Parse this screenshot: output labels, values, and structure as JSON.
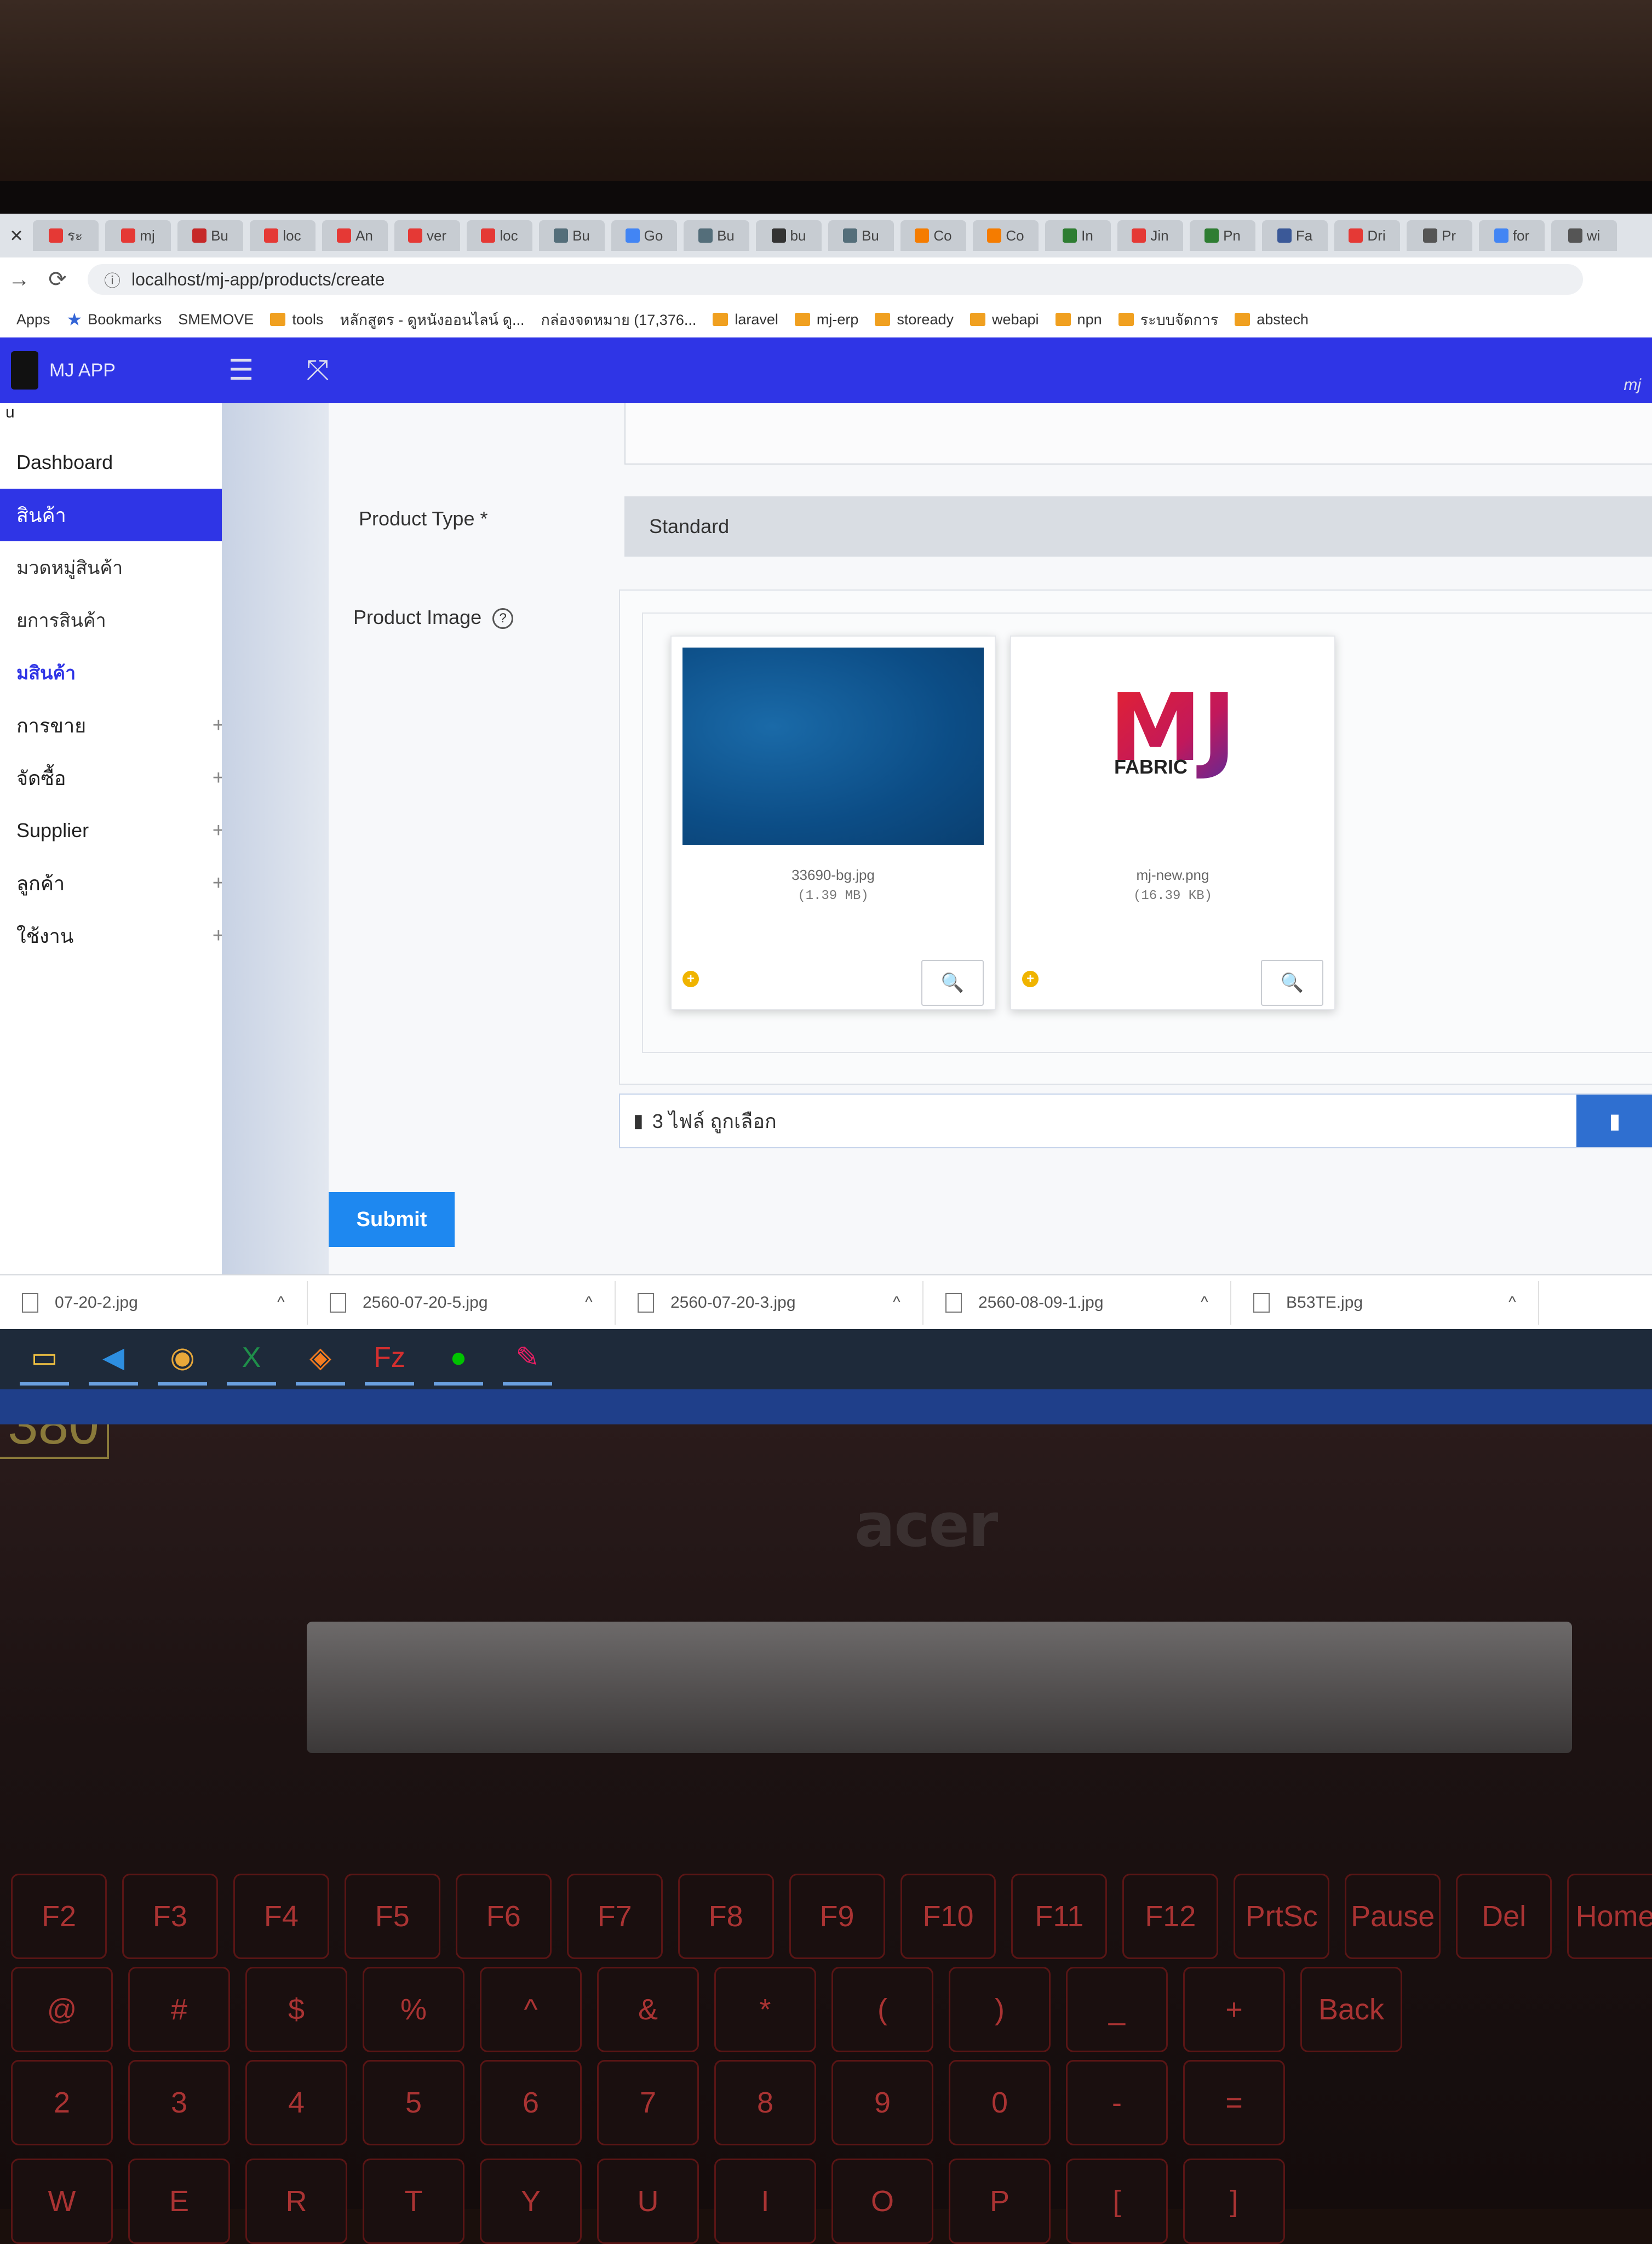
{
  "browser": {
    "tab_close": "×",
    "tabs": [
      {
        "label": "ระ",
        "color": "#e53935"
      },
      {
        "label": "mj",
        "color": "#e53935"
      },
      {
        "label": "Bu",
        "color": "#c62828"
      },
      {
        "label": "loc",
        "color": "#e53935"
      },
      {
        "label": "An",
        "color": "#e53935"
      },
      {
        "label": "ver",
        "color": "#e53935"
      },
      {
        "label": "loc",
        "color": "#e53935"
      },
      {
        "label": "Bu",
        "color": "#546e7a"
      },
      {
        "label": "Go",
        "color": "#4285f4"
      },
      {
        "label": "Bu",
        "color": "#546e7a"
      },
      {
        "label": "bu",
        "color": "#333333"
      },
      {
        "label": "Bu",
        "color": "#546e7a"
      },
      {
        "label": "Co",
        "color": "#f57c00"
      },
      {
        "label": "Co",
        "color": "#f57c00"
      },
      {
        "label": "In",
        "color": "#2e7d32"
      },
      {
        "label": "Jin",
        "color": "#e53935"
      },
      {
        "label": "Pn",
        "color": "#2e7d32"
      },
      {
        "label": "Fa",
        "color": "#3b5998"
      },
      {
        "label": "Dri",
        "color": "#e53935"
      },
      {
        "label": "Pr",
        "color": "#555555"
      },
      {
        "label": "for",
        "color": "#4285f4"
      },
      {
        "label": "wi",
        "color": "#555555"
      }
    ],
    "url": "localhost/mj-app/products/create",
    "bookmarks": [
      {
        "label": "Apps",
        "kind": "apps"
      },
      {
        "label": "Bookmarks",
        "kind": "star"
      },
      {
        "label": "SMEMOVE",
        "kind": "arrow"
      },
      {
        "label": "tools",
        "kind": "folder"
      },
      {
        "label": "หลักสูตร - ดูหนังออนไลน์ ดู...",
        "kind": "site"
      },
      {
        "label": "กล่องจดหมาย (17,376...",
        "kind": "gmail"
      },
      {
        "label": "laravel",
        "kind": "folder"
      },
      {
        "label": "mj-erp",
        "kind": "folder"
      },
      {
        "label": "stoready",
        "kind": "folder"
      },
      {
        "label": "webapi",
        "kind": "folder"
      },
      {
        "label": "npn",
        "kind": "folder"
      },
      {
        "label": "ระบบจัดการ",
        "kind": "folder"
      },
      {
        "label": "abstech",
        "kind": "folder"
      }
    ]
  },
  "app": {
    "name": "MJ APP",
    "hamburger_icon": "☰",
    "fullscreen_icon": "⤧",
    "header_right": "mj"
  },
  "sidebar": {
    "heading": "u",
    "items": [
      {
        "label": "Dashboard",
        "type": "top"
      },
      {
        "label": "สินค้า",
        "type": "active",
        "toggle": "−"
      },
      {
        "label": "มวดหมู่สินค้า",
        "type": "sub"
      },
      {
        "label": "ยการสินค้า",
        "type": "sub"
      },
      {
        "label": "มสินค้า",
        "type": "current"
      },
      {
        "label": "การขาย",
        "type": "group",
        "toggle": "+"
      },
      {
        "label": "จัดซื้อ",
        "type": "group",
        "toggle": "+"
      },
      {
        "label": "Supplier",
        "type": "group",
        "toggle": "+"
      },
      {
        "label": "ลูกค้า",
        "type": "group",
        "toggle": "+"
      },
      {
        "label": "ใช้งาน",
        "type": "group",
        "toggle": "+"
      }
    ]
  },
  "form": {
    "product_type_label": "Product Type *",
    "product_type_value": "Standard",
    "product_image_label": "Product Image",
    "help_icon": "?",
    "previews": [
      {
        "name": "33690-bg.jpg",
        "size": "(1.39 MB)",
        "kind": "blue-texture"
      },
      {
        "name": "mj-new.png",
        "size": "(16.39 KB)",
        "kind": "mj-logo"
      }
    ],
    "logo_text": "FABRIC",
    "logo_letters": "MJ",
    "status_icon": "+",
    "zoom_icon": "🔍",
    "caption": "3 ไฟล์ ถูกเลือก",
    "doc_icon": "▮",
    "browse_icon": "▮",
    "submit_label": "Submit"
  },
  "downloads": [
    {
      "name": "07-20-2.jpg"
    },
    {
      "name": "2560-07-20-5.jpg"
    },
    {
      "name": "2560-07-20-3.jpg"
    },
    {
      "name": "2560-08-09-1.jpg"
    },
    {
      "name": "B53TE.jpg"
    }
  ],
  "download_caret": "^",
  "taskbar": [
    {
      "name": "file-explorer-icon",
      "glyph": "▭",
      "color": "#f3c342"
    },
    {
      "name": "vscode-icon",
      "glyph": "◀",
      "color": "#2d8ee0"
    },
    {
      "name": "chrome-icon",
      "glyph": "◉",
      "color": "#e8a83a"
    },
    {
      "name": "excel-icon",
      "glyph": "X",
      "color": "#1f8f4a"
    },
    {
      "name": "app-icon",
      "glyph": "◈",
      "color": "#f47c20"
    },
    {
      "name": "filezilla-icon",
      "glyph": "Fz",
      "color": "#d32f2f"
    },
    {
      "name": "line-icon",
      "glyph": "●",
      "color": "#00c300"
    },
    {
      "name": "paint-icon",
      "glyph": "✎",
      "color": "#e91e63"
    }
  ],
  "laptop": {
    "brand": "acer",
    "badge": "380",
    "keyboard_rows": [
      [
        "F2",
        "F3",
        "F4",
        "F5",
        "F6",
        "F7",
        "F8",
        "F9",
        "F10",
        "F11",
        "F12",
        "PrtSc",
        "Pause",
        "Del",
        "Home"
      ],
      [
        "@",
        "#",
        "$",
        "%",
        "^",
        "&",
        "*",
        "(",
        ")",
        "_",
        "+",
        "Back"
      ],
      [
        "2",
        "3",
        "4",
        "5",
        "6",
        "7",
        "8",
        "9",
        "0",
        "-",
        "="
      ],
      [
        "W",
        "E",
        "R",
        "T",
        "Y",
        "U",
        "I",
        "O",
        "P",
        "[",
        "]"
      ]
    ]
  }
}
